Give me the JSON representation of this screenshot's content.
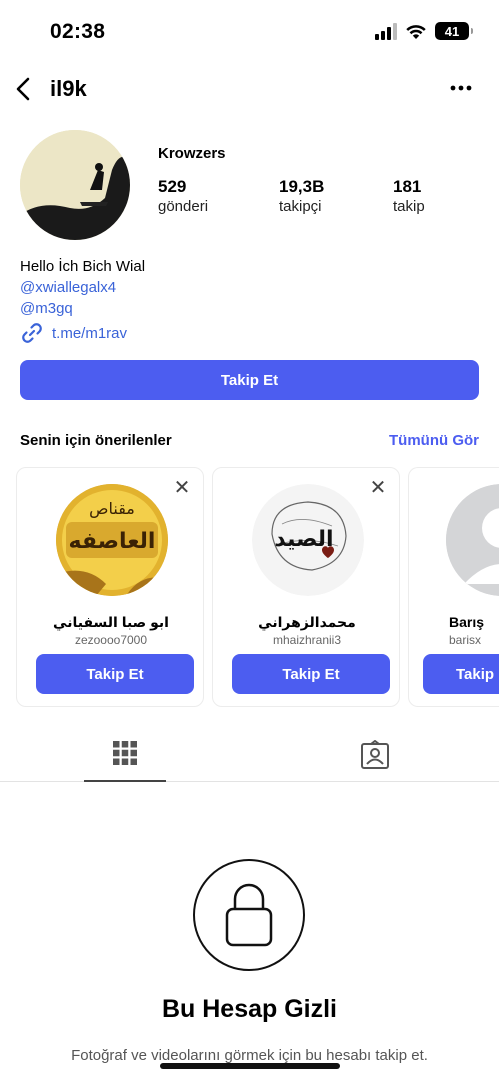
{
  "status": {
    "time": "02:38",
    "battery": "41"
  },
  "header": {
    "username": "il9k"
  },
  "profile": {
    "display_name": "Krowzers",
    "stats": [
      {
        "value": "529",
        "label": "gönderi"
      },
      {
        "value": "19,3B",
        "label": "takipçi"
      },
      {
        "value": "181",
        "label": "takip"
      }
    ],
    "bio": "Hello İch Bich Wial",
    "mentions": [
      "@xwiallegalx4",
      "@m3gq"
    ],
    "link": "t.me/m1rav",
    "follow_label": "Takip Et"
  },
  "suggestions": {
    "title": "Senin için önerilenler",
    "see_all": "Tümünü Gör",
    "items": [
      {
        "name": "ابو صبا السفياني",
        "handle": "zezoooo7000",
        "button": "Takip Et",
        "avatar_text_top": "مقناص",
        "avatar_text_main": "العاصفه"
      },
      {
        "name": "محمدالزهراني",
        "handle": "mhaizhranii3",
        "button": "Takip Et",
        "avatar_text_main": "الصيد"
      },
      {
        "name": "Barış",
        "handle": "barisx",
        "button": "Takip Et"
      }
    ]
  },
  "private": {
    "title": "Bu Hesap Gizli",
    "description": "Fotoğraf ve videolarını görmek için bu hesabı takip et."
  },
  "colors": {
    "accent": "#4c5df0",
    "link": "#3a63d8"
  }
}
